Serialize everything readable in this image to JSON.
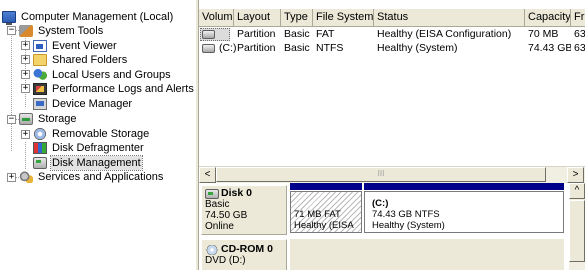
{
  "tree": {
    "root": "Computer Management (Local)",
    "system_tools": "System Tools",
    "event_viewer": "Event Viewer",
    "shared_folders": "Shared Folders",
    "local_users": "Local Users and Groups",
    "perf_logs": "Performance Logs and Alerts",
    "device_manager": "Device Manager",
    "storage": "Storage",
    "removable_storage": "Removable Storage",
    "disk_defragmenter": "Disk Defragmenter",
    "disk_management": "Disk Management",
    "services_apps": "Services and Applications"
  },
  "volume_list": {
    "columns": [
      "Volume",
      "Layout",
      "Type",
      "File System",
      "Status",
      "Capacity",
      "Fr"
    ],
    "rows": [
      [
        "",
        "Partition",
        "Basic",
        "FAT",
        "Healthy (EISA Configuration)",
        "70 MB",
        "63"
      ],
      [
        "(C:)",
        "Partition",
        "Basic",
        "NTFS",
        "Healthy (System)",
        "74.43 GB",
        "63"
      ]
    ]
  },
  "scrollbar": {
    "left_arrow": "<",
    "right_arrow": ">",
    "grip": "III",
    "up_arrow": "^",
    "down_arrow": "v"
  },
  "disks": {
    "disk0": {
      "name": "Disk 0",
      "type": "Basic",
      "size": "74.50 GB",
      "status": "Online",
      "partitions": [
        {
          "label": "",
          "size_fs": "71 MB FAT",
          "status": "Healthy (EISA"
        },
        {
          "label": "(C:)",
          "size_fs": "74.43 GB NTFS",
          "status": "Healthy (System)"
        }
      ]
    },
    "cdrom0": {
      "name": "CD-ROM 0",
      "drive": "DVD (D:)"
    }
  },
  "colors": {
    "partition_bar": "#00008b",
    "chrome": "#ece9d8"
  }
}
